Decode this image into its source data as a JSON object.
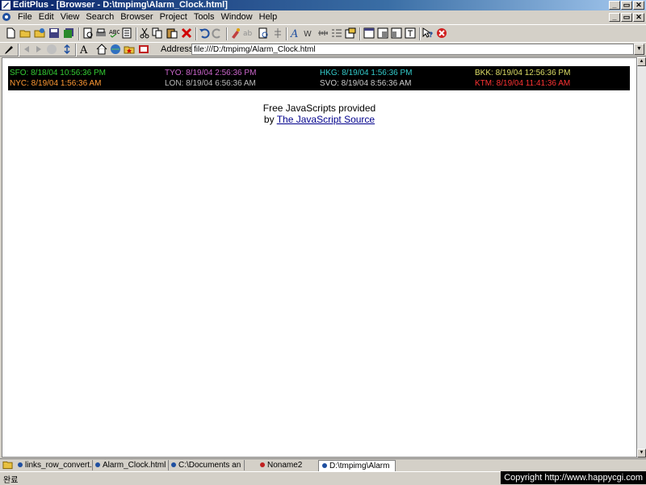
{
  "window": {
    "title": "EditPlus - [Browser - D:\\tmpimg\\Alarm_Clock.html]",
    "controls": [
      "_",
      "▭",
      "✕"
    ]
  },
  "menu": {
    "items": [
      "File",
      "Edit",
      "View",
      "Search",
      "Browser",
      "Project",
      "Tools",
      "Window",
      "Help"
    ]
  },
  "address": {
    "label": "Address",
    "value": "file:///D:/tmpimg/Alarm_Clock.html"
  },
  "clocks": [
    {
      "label": "SFO: 8/18/04 10:56:36 PM",
      "color": "#33cc33"
    },
    {
      "label": "TYO: 8/19/04 2:56:36 PM",
      "color": "#cc66cc"
    },
    {
      "label": "HKG: 8/19/04 1:56:36 PM",
      "color": "#33cccc"
    },
    {
      "label": "BKK: 8/19/04 12:56:36 PM",
      "color": "#dddd66"
    },
    {
      "label": "NYC: 8/19/04 1:56:36 AM",
      "color": "#ff9933"
    },
    {
      "label": "LON: 8/19/04 6:56:36 AM",
      "color": "#bbbbbb"
    },
    {
      "label": "SVO: 8/19/04 8:56:36 AM",
      "color": "#cccccc"
    },
    {
      "label": "KTM: 8/19/04 11:41:36 AM",
      "color": "#ff3333"
    }
  ],
  "credit": {
    "line1": "Free JavaScripts provided",
    "by": "by",
    "link": "The JavaScript Source"
  },
  "tabs": [
    {
      "label": "links_row_convert.i",
      "icon": "blue-dot-icon"
    },
    {
      "label": "Alarm_Clock.html",
      "icon": "blue-dot-icon"
    },
    {
      "label": "C:\\Documents an",
      "icon": "blue-dot-icon"
    },
    {
      "label": "Noname2",
      "icon": "red-dot-icon"
    },
    {
      "label": "D:\\tmpimg\\Alarm",
      "icon": "blue-dot-icon"
    }
  ],
  "status": {
    "text": "완료",
    "copyright": "Copyright  http://www.happycgi.com"
  }
}
